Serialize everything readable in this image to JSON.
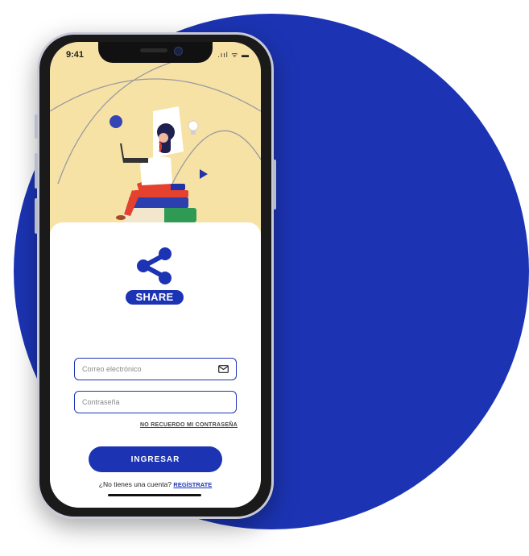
{
  "status_bar": {
    "time": "9:41",
    "icons": ".ııl ᯤ ▬"
  },
  "brand": {
    "name": "SHARE",
    "color": "#1c34b4"
  },
  "login": {
    "email_placeholder": "Correo electrónico",
    "password_placeholder": "Contraseña",
    "forgot_label": "No recuerdo mi contraseña",
    "submit_label": "INGRESAR",
    "signup_prompt": "¿No tienes una cuenta?",
    "signup_link": "Regístrate"
  },
  "colors": {
    "accent": "#1c34b4",
    "header_bg": "#f7e2a6",
    "circle": "#1c34b4"
  },
  "icons": [
    "share-icon",
    "mail-icon",
    "lightbulb-icon",
    "play-triangle-icon"
  ]
}
